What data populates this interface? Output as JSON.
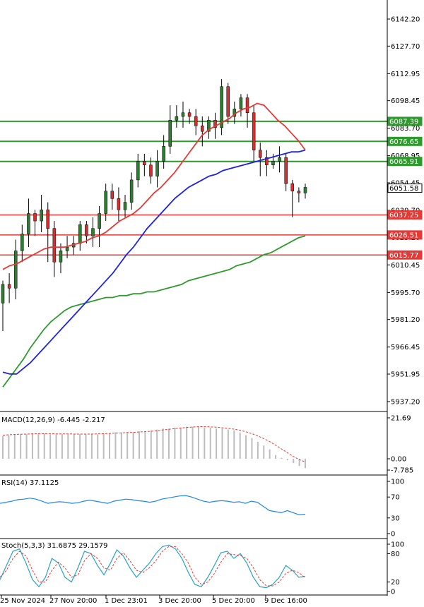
{
  "colors": {
    "background": "#ffffff",
    "bull": "#2e7d32",
    "bear": "#d32f2f",
    "wick": "#000000",
    "ma_fast": "#e53935",
    "ma_mid": "#1e22e0",
    "ma_slow": "#2e9a2e",
    "support_line": "#e53935",
    "resistance_line": "#2e9a2e",
    "macd_hist": "#bdbdbd",
    "macd_signal": "#e53935",
    "rsi": "#1e88e5",
    "stoch_main": "#26a3c8",
    "stoch_signal": "#e53935",
    "axis": "#000000",
    "label_red_bg": "#e53935",
    "label_green_bg": "#2e9a2e"
  },
  "chart_data": [
    {
      "type": "candlestick",
      "ylim": [
        5930,
        6150
      ],
      "yticks": [
        "6142.20",
        "6127.70",
        "6112.95",
        "6098.45",
        "6083.70",
        "6068.95",
        "6054.45",
        "6039.70",
        "6025.20",
        "6010.45",
        "5995.70",
        "5981.20",
        "5966.45",
        "5951.95",
        "5937.20"
      ],
      "xticks": [
        "25 Nov 2024",
        "27 Nov 20:00",
        "1 Dec 23:01",
        "3 Dec 20:00",
        "5 Dec 20:00",
        "9 Dec 16:00"
      ],
      "price_labels": [
        {
          "text": "6087.39",
          "color": "green"
        },
        {
          "text": "6076.65",
          "color": "green"
        },
        {
          "text": "6065.91",
          "color": "green"
        },
        {
          "text": "6051.58",
          "color": "plain"
        },
        {
          "text": "6037.25",
          "color": "red"
        },
        {
          "text": "6026.51",
          "color": "red"
        },
        {
          "text": "6015.77",
          "color": "red"
        }
      ],
      "levels": {
        "green": [
          6087.39,
          6076.65,
          6065.91
        ],
        "red": [
          6037.25,
          6026.51,
          6015.77
        ]
      },
      "candles": [
        [
          5990,
          6000,
          5975,
          6002
        ],
        [
          6000,
          5998,
          5990,
          6006
        ],
        [
          5998,
          6018,
          5992,
          6024
        ],
        [
          6018,
          6027,
          6012,
          6032
        ],
        [
          6027,
          6038,
          6020,
          6046
        ],
        [
          6038,
          6034,
          6026,
          6040
        ],
        [
          6034,
          6040,
          6028,
          6048
        ],
        [
          6040,
          6030,
          6012,
          6044
        ],
        [
          6030,
          6012,
          6004,
          6034
        ],
        [
          6012,
          6018,
          6006,
          6022
        ],
        [
          6018,
          6020,
          6014,
          6026
        ],
        [
          6020,
          6022,
          6016,
          6026
        ],
        [
          6022,
          6032,
          6018,
          6034
        ],
        [
          6032,
          6026,
          6022,
          6034
        ],
        [
          6026,
          6030,
          6020,
          6036
        ],
        [
          6030,
          6038,
          6020,
          6042
        ],
        [
          6038,
          6050,
          6034,
          6054
        ],
        [
          6050,
          6046,
          6040,
          6054
        ],
        [
          6046,
          6040,
          6034,
          6052
        ],
        [
          6040,
          6044,
          6036,
          6048
        ],
        [
          6044,
          6056,
          6040,
          6060
        ],
        [
          6056,
          6066,
          6052,
          6070
        ],
        [
          6066,
          6064,
          6058,
          6070
        ],
        [
          6064,
          6058,
          6054,
          6068
        ],
        [
          6058,
          6066,
          6052,
          6072
        ],
        [
          6066,
          6074,
          6062,
          6080
        ],
        [
          6074,
          6088,
          6070,
          6096
        ],
        [
          6088,
          6090,
          6084,
          6096
        ],
        [
          6090,
          6092,
          6084,
          6098
        ],
        [
          6092,
          6090,
          6086,
          6094
        ],
        [
          6090,
          6085,
          6080,
          6094
        ],
        [
          6085,
          6082,
          6074,
          6090
        ],
        [
          6082,
          6088,
          6078,
          6090
        ],
        [
          6088,
          6084,
          6078,
          6092
        ],
        [
          6084,
          6106,
          6080,
          6110
        ],
        [
          6106,
          6090,
          6086,
          6108
        ],
        [
          6090,
          6094,
          6086,
          6098
        ],
        [
          6094,
          6100,
          6090,
          6102
        ],
        [
          6100,
          6092,
          6084,
          6102
        ],
        [
          6092,
          6072,
          6066,
          6096
        ],
        [
          6072,
          6068,
          6058,
          6076
        ],
        [
          6068,
          6064,
          6058,
          6072
        ],
        [
          6064,
          6066,
          6062,
          6070
        ],
        [
          6066,
          6068,
          6060,
          6074
        ],
        [
          6068,
          6054,
          6050,
          6070
        ],
        [
          6054,
          6050,
          6036,
          6056
        ],
        [
          6050,
          6049,
          6044,
          6052
        ],
        [
          6049,
          6052,
          6046,
          6054
        ]
      ],
      "ma_fast": [
        6008,
        6010,
        6011,
        6013,
        6015,
        6017,
        6019,
        6020,
        6020,
        6020,
        6021,
        6022,
        6023,
        6025,
        6026,
        6028,
        6031,
        6034,
        6036,
        6038,
        6041,
        6045,
        6049,
        6052,
        6056,
        6060,
        6065,
        6070,
        6075,
        6080,
        6083,
        6085,
        6087,
        6089,
        6092,
        6094,
        6095,
        6097,
        6096,
        6092,
        6088,
        6085,
        6081,
        6077,
        6072
      ],
      "ma_mid": [
        5953,
        5952,
        5952,
        5955,
        5958,
        5962,
        5966,
        5970,
        5974,
        5978,
        5982,
        5986,
        5990,
        5994,
        5998,
        6002,
        6006,
        6011,
        6016,
        6020,
        6025,
        6030,
        6034,
        6038,
        6042,
        6046,
        6049,
        6052,
        6054,
        6056,
        6058,
        6059,
        6061,
        6062,
        6063,
        6064,
        6065,
        6066,
        6067,
        6068,
        6069,
        6070,
        6071,
        6071,
        6072
      ],
      "ma_slow": [
        5945,
        5950,
        5955,
        5960,
        5966,
        5971,
        5976,
        5980,
        5983,
        5986,
        5988,
        5989,
        5990,
        5991,
        5992,
        5993,
        5993,
        5994,
        5994,
        5995,
        5995,
        5996,
        5996,
        5997,
        5998,
        5999,
        6000,
        6002,
        6003,
        6004,
        6005,
        6006,
        6007,
        6008,
        6010,
        6011,
        6012,
        6014,
        6016,
        6017,
        6019,
        6021,
        6023,
        6025,
        6026
      ]
    },
    {
      "type": "bar",
      "name": "MACD(12,26,9)",
      "label": "MACD(12,26,9) -6.445 -2.217",
      "ylim": [
        -7.785,
        21.69
      ],
      "yticks": [
        "21.69",
        "0.00",
        "-7.785"
      ],
      "hist": [
        12,
        12.5,
        13,
        13,
        13,
        13.5,
        13.5,
        13.5,
        13,
        13,
        13,
        13,
        13,
        13,
        13,
        13,
        13,
        13.5,
        13.5,
        14,
        14,
        14,
        14,
        14.5,
        14.5,
        15,
        15.5,
        16,
        16,
        16.5,
        16.5,
        17,
        17,
        17,
        16.5,
        16.5,
        16,
        16,
        15.5,
        15,
        14,
        12.5,
        11,
        9,
        7,
        5,
        2,
        0.5,
        -1,
        -3,
        -5,
        -6.4
      ],
      "signal": [
        12.5,
        12.7,
        12.9,
        13,
        13.1,
        13.2,
        13.3,
        13.3,
        13.3,
        13.2,
        13.2,
        13.2,
        13.1,
        13.1,
        13.1,
        13.1,
        13.2,
        13.3,
        13.4,
        13.6,
        13.7,
        13.9,
        14,
        14.2,
        14.4,
        14.6,
        14.9,
        15.3,
        15.6,
        16,
        16.3,
        16.6,
        16.8,
        17,
        17,
        16.9,
        16.7,
        16.4,
        16.1,
        15.7,
        15.1,
        14.3,
        13.3,
        12.1,
        10.7,
        9.1,
        7.2,
        5.2,
        3.2,
        1.2,
        -0.6,
        -2.2
      ]
    },
    {
      "type": "line",
      "name": "RSI(14)",
      "label": "RSI(14) 37.1125",
      "ylim": [
        0,
        100
      ],
      "yticks": [
        "100",
        "70",
        "30",
        "0"
      ],
      "values": [
        58,
        60,
        62,
        65,
        66,
        68,
        66,
        62,
        58,
        60,
        61,
        60,
        58,
        59,
        62,
        64,
        62,
        60,
        58,
        62,
        64,
        66,
        65,
        63,
        62,
        60,
        62,
        66,
        68,
        70,
        72,
        73,
        70,
        66,
        62,
        60,
        62,
        63,
        62,
        60,
        61,
        58,
        62,
        60,
        52,
        44,
        42,
        40,
        44,
        40,
        36,
        37
      ]
    },
    {
      "type": "line",
      "name": "Stoch(5,3,3)",
      "label": "Stoch(5,3,3) 31.6875 29.1579",
      "ylim": [
        0,
        100
      ],
      "yticks": [
        "100",
        "80",
        "20",
        "0"
      ],
      "main": [
        25,
        55,
        85,
        90,
        60,
        25,
        10,
        30,
        70,
        60,
        30,
        20,
        50,
        85,
        80,
        55,
        35,
        60,
        88,
        75,
        50,
        30,
        45,
        60,
        80,
        95,
        98,
        90,
        70,
        40,
        15,
        10,
        30,
        55,
        82,
        85,
        70,
        80,
        60,
        30,
        10,
        8,
        15,
        30,
        55,
        45,
        30,
        32
      ],
      "signal": [
        30,
        45,
        70,
        85,
        75,
        45,
        20,
        20,
        45,
        62,
        50,
        30,
        35,
        65,
        80,
        70,
        50,
        45,
        70,
        82,
        65,
        45,
        40,
        50,
        65,
        85,
        95,
        95,
        80,
        60,
        30,
        15,
        20,
        38,
        62,
        80,
        78,
        76,
        70,
        50,
        25,
        12,
        12,
        20,
        38,
        45,
        40,
        29
      ]
    }
  ]
}
